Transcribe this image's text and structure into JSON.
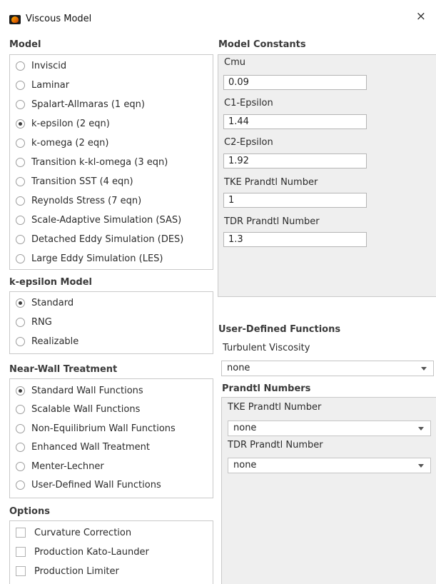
{
  "window": {
    "title": "Viscous Model",
    "close_glyph": "×"
  },
  "model": {
    "header": "Model",
    "options": [
      {
        "label": "Inviscid",
        "selected": false
      },
      {
        "label": "Laminar",
        "selected": false
      },
      {
        "label": "Spalart-Allmaras (1 eqn)",
        "selected": false
      },
      {
        "label": "k-epsilon (2 eqn)",
        "selected": true
      },
      {
        "label": "k-omega (2 eqn)",
        "selected": false
      },
      {
        "label": "Transition k-kl-omega (3 eqn)",
        "selected": false
      },
      {
        "label": "Transition SST (4 eqn)",
        "selected": false
      },
      {
        "label": "Reynolds Stress (7 eqn)",
        "selected": false
      },
      {
        "label": "Scale-Adaptive Simulation (SAS)",
        "selected": false
      },
      {
        "label": "Detached Eddy Simulation (DES)",
        "selected": false
      },
      {
        "label": "Large Eddy Simulation (LES)",
        "selected": false
      }
    ]
  },
  "k_epsilon_model": {
    "header": "k-epsilon Model",
    "options": [
      {
        "label": "Standard",
        "selected": true
      },
      {
        "label": "RNG",
        "selected": false
      },
      {
        "label": "Realizable",
        "selected": false
      }
    ]
  },
  "near_wall": {
    "header": "Near-Wall Treatment",
    "options": [
      {
        "label": "Standard Wall Functions",
        "selected": true
      },
      {
        "label": "Scalable Wall Functions",
        "selected": false
      },
      {
        "label": "Non-Equilibrium Wall Functions",
        "selected": false
      },
      {
        "label": "Enhanced Wall Treatment",
        "selected": false
      },
      {
        "label": "Menter-Lechner",
        "selected": false
      },
      {
        "label": "User-Defined Wall Functions",
        "selected": false
      }
    ]
  },
  "options": {
    "header": "Options",
    "items": [
      {
        "label": "Curvature Correction",
        "checked": false
      },
      {
        "label": "Production Kato-Launder",
        "checked": false
      },
      {
        "label": "Production Limiter",
        "checked": false
      }
    ]
  },
  "model_constants": {
    "header": "Model Constants",
    "items": [
      {
        "label": "Cmu",
        "value": "0.09"
      },
      {
        "label": "C1-Epsilon",
        "value": "1.44"
      },
      {
        "label": "C2-Epsilon",
        "value": "1.92"
      },
      {
        "label": "TKE Prandtl Number",
        "value": "1"
      },
      {
        "label": "TDR Prandtl Number",
        "value": "1.3"
      }
    ]
  },
  "udf": {
    "header": "User-Defined Functions",
    "turbulent_viscosity_label": "Turbulent Viscosity",
    "turbulent_viscosity_value": "none",
    "prandtl_header": "Prandtl Numbers",
    "tke_label": "TKE Prandtl Number",
    "tke_value": "none",
    "tdr_label": "TDR Prandtl Number",
    "tdr_value": "none"
  }
}
